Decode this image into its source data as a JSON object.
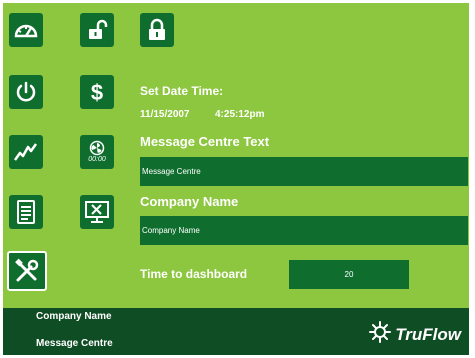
{
  "nav_left": [
    {
      "name": "dashboard-button",
      "icon": "gauge-icon"
    },
    {
      "name": "power-button",
      "icon": "power-icon"
    },
    {
      "name": "trend-button",
      "icon": "trend-chart-icon"
    },
    {
      "name": "report-button",
      "icon": "document-icon"
    },
    {
      "name": "settings-button",
      "icon": "tools-icon",
      "active": true
    }
  ],
  "nav_right": [
    {
      "name": "unlock-button",
      "icon": "unlocked-padlock-icon"
    },
    {
      "name": "pricing-button",
      "icon": "dollar-icon"
    },
    {
      "name": "fan-timer-button",
      "icon": "fan-clock-icon",
      "text": "00:00"
    },
    {
      "name": "service-button",
      "icon": "monitor-tools-icon"
    }
  ],
  "lock": {
    "icon": "locked-padlock-icon"
  },
  "settings": {
    "date_time_label": "Set Date Time:",
    "date": "11/15/2007",
    "time": "4:25:12pm",
    "message_label": "Message Centre Text",
    "message_value": "Message Centre",
    "company_label": "Company Name",
    "company_value": "Company Name",
    "dashboard_label": "Time to dashboard",
    "dashboard_value": "20"
  },
  "footer": {
    "company": "Company Name",
    "message": "Message Centre",
    "logo_text": "TruFlow",
    "logo_icon": "truflow-burst-icon"
  },
  "colors": {
    "background": "#8dc63f",
    "button": "#0f6e2e",
    "footer": "#0f4d24",
    "text": "#ffffff"
  }
}
